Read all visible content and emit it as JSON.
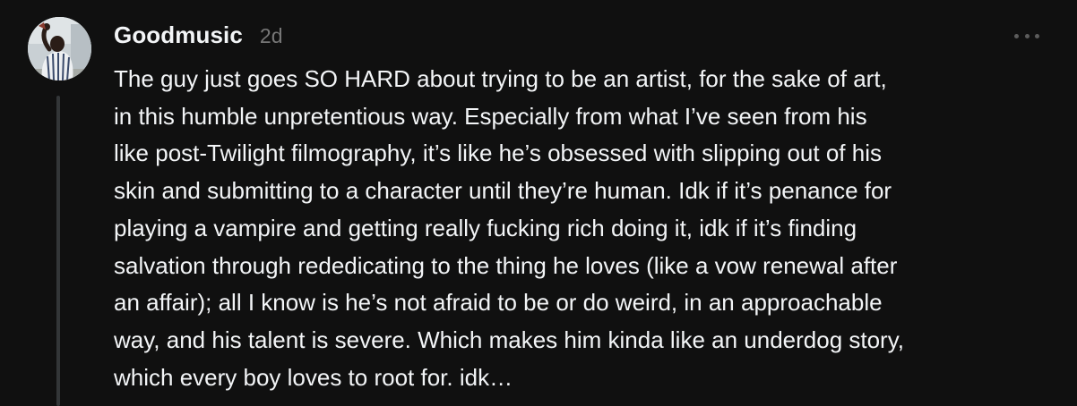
{
  "post": {
    "username": "Goodmusic",
    "time": "2d",
    "more_icon": "more-horizontal-icon",
    "lines": [
      "The guy just goes SO HARD about trying to be an artist, for the sake of art,",
      "in this humble unpretentious way. Especially from what I’ve seen from his",
      "like post-Twilight filmography, it’s like he’s obsessed with slipping out of his",
      "skin and submitting to a character until they’re human. Idk if it’s penance for",
      "playing a vampire and getting really fucking rich doing it, idk if it’s finding",
      "salvation through rededicating to the thing he loves (like a vow renewal after",
      "an affair); all I know is he’s not afraid to be or do weird, in an approachable",
      "way, and his talent is severe. Which makes him kinda like an underdog story,",
      "which every boy loves to root for. idk…"
    ]
  },
  "colors": {
    "background": "#101010",
    "text_primary": "#f3f5f7",
    "text_secondary": "#777777",
    "thread_line": "#333638"
  }
}
